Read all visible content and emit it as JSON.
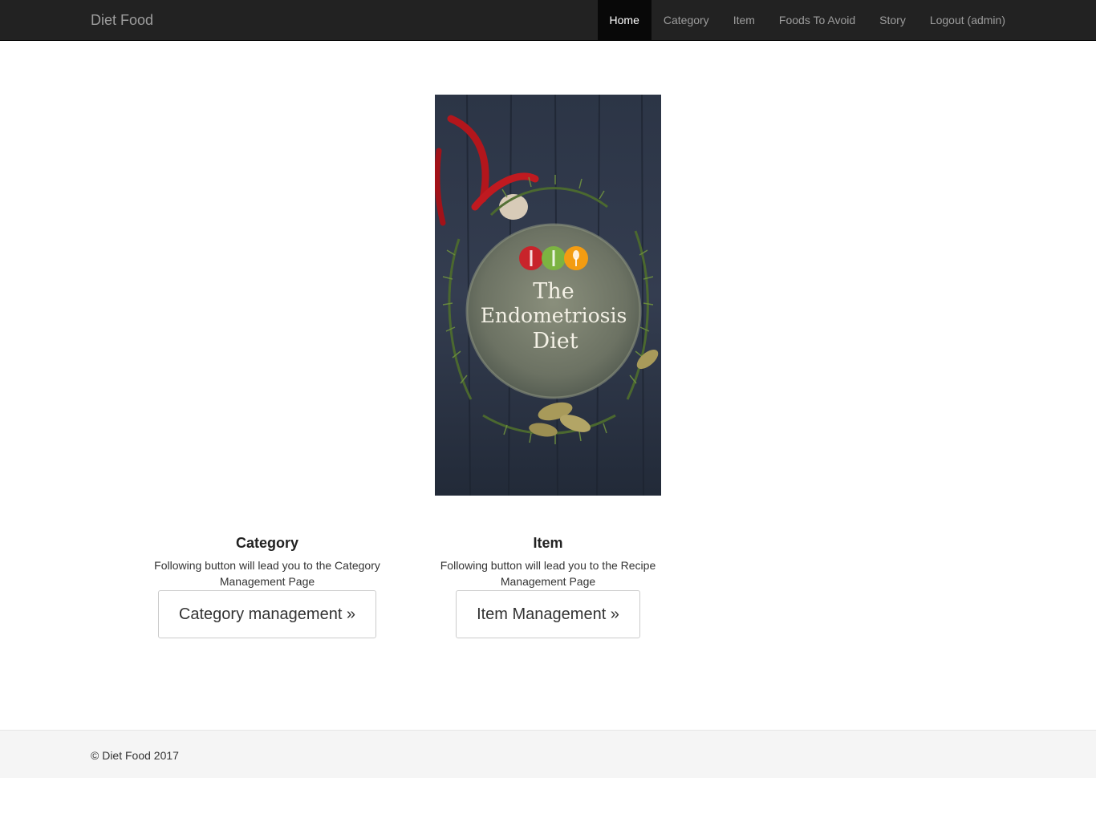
{
  "navbar": {
    "brand": "Diet Food",
    "items": [
      {
        "label": "Home",
        "active": true
      },
      {
        "label": "Category",
        "active": false
      },
      {
        "label": "Item",
        "active": false
      },
      {
        "label": "Foods To Avoid",
        "active": false
      },
      {
        "label": "Story",
        "active": false
      },
      {
        "label": "Logout (admin)",
        "active": false
      }
    ]
  },
  "hero": {
    "line1": "The",
    "line2": "Endometriosis",
    "line3": "Diet"
  },
  "features": [
    {
      "title": "Category",
      "description": "Following button will lead you to the Category Management Page",
      "button_label": "Category management »"
    },
    {
      "title": "Item",
      "description": "Following button will lead you to the Recipe Management Page",
      "button_label": "Item Management »"
    }
  ],
  "footer": {
    "copyright": "© Diet Food 2017"
  },
  "colors": {
    "navbar_bg": "#222222",
    "nav_active_bg": "#080808",
    "nav_text": "#9d9d9d",
    "footer_bg": "#f5f5f5",
    "logo_red": "#c8242b",
    "logo_green": "#7cb342",
    "logo_orange": "#f39c12"
  }
}
